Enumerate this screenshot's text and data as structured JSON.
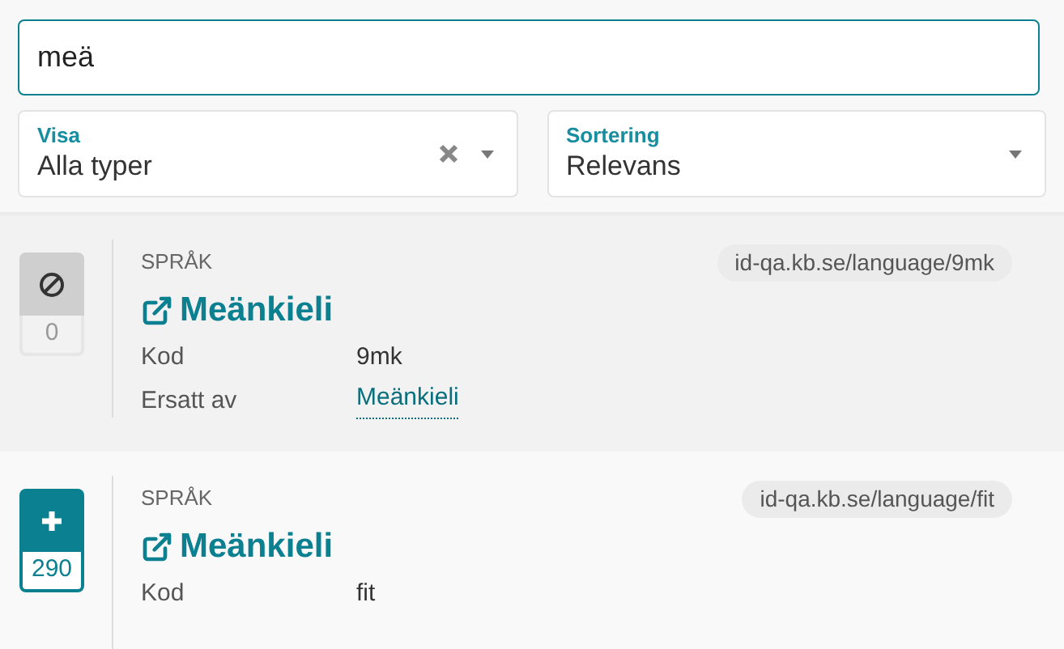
{
  "search": {
    "value": "meä"
  },
  "filters": [
    {
      "label": "Visa",
      "value": "Alla typer",
      "clearable": true
    },
    {
      "label": "Sortering",
      "value": "Relevans",
      "clearable": false
    }
  ],
  "results": [
    {
      "disabled": true,
      "count": "0",
      "type": "SPRÅK",
      "uri": "id-qa.kb.se/language/9mk",
      "title": "Meänkieli",
      "properties": [
        {
          "kind": "text",
          "label": "Kod",
          "value": "9mk"
        },
        {
          "kind": "link",
          "label": "Ersatt av",
          "value": "Meänkieli"
        }
      ]
    },
    {
      "disabled": false,
      "count": "290",
      "type": "SPRÅK",
      "uri": "id-qa.kb.se/language/fit",
      "title": "Meänkieli",
      "properties": [
        {
          "kind": "text",
          "label": "Kod",
          "value": "fit"
        }
      ]
    }
  ]
}
